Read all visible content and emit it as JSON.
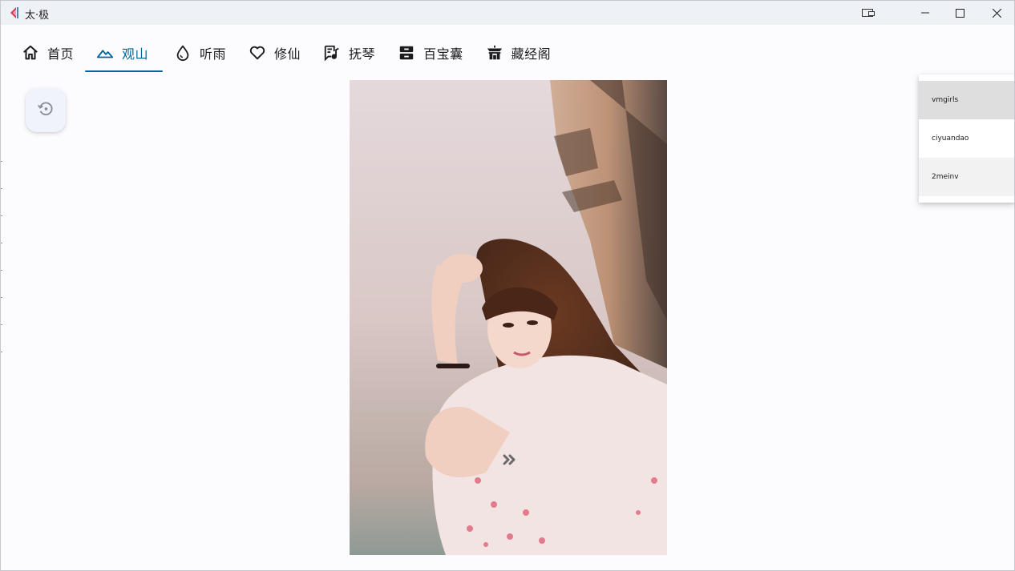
{
  "window": {
    "title": "太·极",
    "icons": {
      "app": "taiji-logo-icon",
      "cast": "cast-icon",
      "minimize": "minimize-icon",
      "maximize": "maximize-icon",
      "close": "close-icon"
    }
  },
  "tabs": [
    {
      "label": "首页",
      "icon": "home-icon",
      "active": false
    },
    {
      "label": "观山",
      "icon": "mountain-icon",
      "active": true
    },
    {
      "label": "听雨",
      "icon": "water-drop-icon",
      "active": false
    },
    {
      "label": "修仙",
      "icon": "heart-icon",
      "active": false
    },
    {
      "label": "抚琴",
      "icon": "music-lyrics-icon",
      "active": false
    },
    {
      "label": "百宝囊",
      "icon": "inbox-icon",
      "active": false
    },
    {
      "label": "藏经阁",
      "icon": "temple-icon",
      "active": false
    }
  ],
  "history_button": {
    "icon": "history-icon"
  },
  "viewer": {
    "image": "portrait-photo",
    "next_icon": "double-chevron-right-icon"
  },
  "source_menu": {
    "items": [
      "vmgirls",
      "ciyuandao",
      "2meinv"
    ],
    "selected": "vmgirls"
  },
  "colors": {
    "accent": "#00639b",
    "background": "#fcfcff",
    "titlebar": "#eef2f7"
  }
}
